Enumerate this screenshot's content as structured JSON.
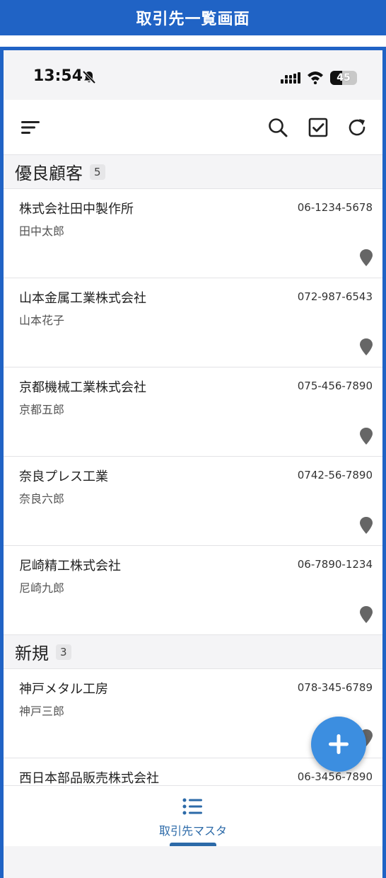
{
  "banner": {
    "title": "取引先一覧画面"
  },
  "status_bar": {
    "time": "13:54",
    "battery_level": "45"
  },
  "toolbar": {
    "menu_icon": "menu-lines-icon",
    "search_icon": "search-icon",
    "select_icon": "checkbox-icon",
    "refresh_icon": "refresh-icon"
  },
  "groups": [
    {
      "title": "優良顧客",
      "count": "5",
      "items": [
        {
          "company": "株式会社田中製作所",
          "person": "田中太郎",
          "phone": "06-1234-5678"
        },
        {
          "company": "山本金属工業株式会社",
          "person": "山本花子",
          "phone": "072-987-6543"
        },
        {
          "company": "京都機械工業株式会社",
          "person": "京都五郎",
          "phone": "075-456-7890"
        },
        {
          "company": "奈良プレス工業",
          "person": "奈良六郎",
          "phone": "0742-56-7890"
        },
        {
          "company": "尼崎精工株式会社",
          "person": "尼崎九郎",
          "phone": "06-7890-1234"
        }
      ]
    },
    {
      "title": "新規",
      "count": "3",
      "items": [
        {
          "company": "神戸メタル工房",
          "person": "神戸三郎",
          "phone": "078-345-6789"
        },
        {
          "company": "西日本部品販売株式会社",
          "person": "",
          "phone": "06-3456-7890"
        }
      ]
    }
  ],
  "fab": {
    "icon": "plus-icon"
  },
  "bottom_nav": {
    "label": "取引先マスタ",
    "icon": "list-icon"
  },
  "colors": {
    "banner": "#2063c5",
    "accent": "#3c8ee0",
    "nav_active": "#2c6aa8"
  }
}
